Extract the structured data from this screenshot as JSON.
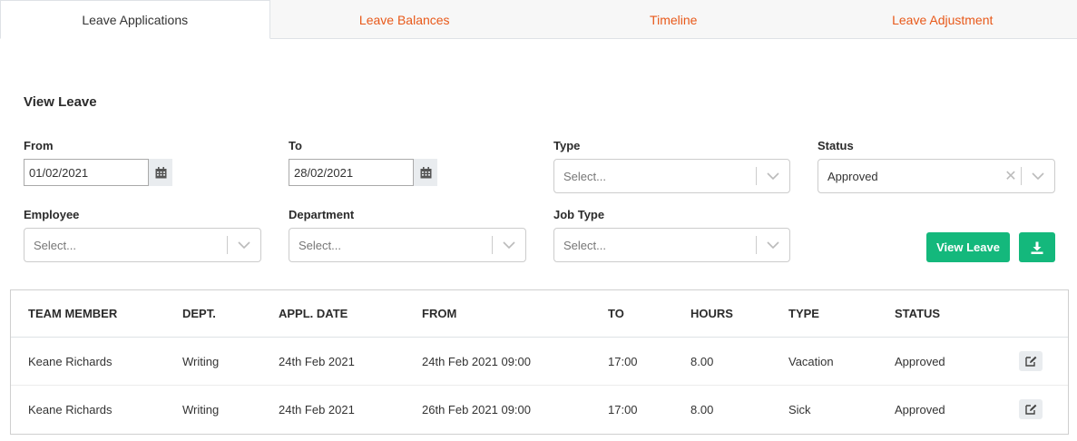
{
  "tabs": [
    {
      "label": "Leave Applications",
      "active": true
    },
    {
      "label": "Leave Balances",
      "active": false
    },
    {
      "label": "Timeline",
      "active": false
    },
    {
      "label": "Leave Adjustment",
      "active": false
    }
  ],
  "filters": {
    "title": "View Leave",
    "from": {
      "label": "From",
      "value": "01/02/2021"
    },
    "to": {
      "label": "To",
      "value": "28/02/2021"
    },
    "type": {
      "label": "Type",
      "placeholder": "Select..."
    },
    "status": {
      "label": "Status",
      "value": "Approved"
    },
    "employee": {
      "label": "Employee",
      "placeholder": "Select..."
    },
    "department": {
      "label": "Department",
      "placeholder": "Select..."
    },
    "job_type": {
      "label": "Job Type",
      "placeholder": "Select..."
    },
    "view_button": "View Leave"
  },
  "table": {
    "columns": [
      "TEAM MEMBER",
      "DEPT.",
      "APPL. DATE",
      "FROM",
      "TO",
      "HOURS",
      "TYPE",
      "STATUS"
    ],
    "rows": [
      [
        "Keane Richards",
        "Writing",
        "24th Feb 2021",
        "24th Feb 2021 09:00",
        "17:00",
        "8.00",
        "Vacation",
        "Approved"
      ],
      [
        "Keane Richards",
        "Writing",
        "24th Feb 2021",
        "26th Feb 2021 09:00",
        "17:00",
        "8.00",
        "Sick",
        "Approved"
      ]
    ]
  },
  "icons": {
    "calendar": "calendar-icon",
    "chevron": "chevron-down-icon",
    "clear": "clear-icon",
    "download": "download-icon",
    "edit": "edit-icon"
  },
  "colors": {
    "accent": "#e8591a",
    "primary_button": "#14b87c"
  }
}
